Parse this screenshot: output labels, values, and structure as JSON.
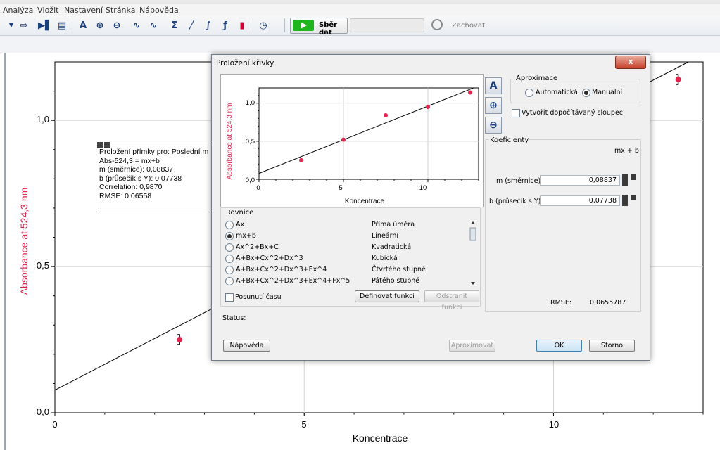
{
  "menu": [
    "Analýza",
    "Vložit",
    "Nastavení",
    "Stránka",
    "Nápověda"
  ],
  "toolbar": {
    "collect_label": "Sběr dat",
    "keep_label": "Zachovat"
  },
  "graph": {
    "y_axis_title": "Absorbance at 524,3 nm",
    "x_axis_title": "Koncentrace",
    "y_ticks": [
      "0,0",
      "0,5",
      "1,0"
    ],
    "x_ticks": [
      "0",
      "5",
      "10"
    ],
    "accent_color": "#e0254f"
  },
  "fit_box": {
    "line1": "Proložení přímky pro: Poslední m",
    "line2": "Abs-524,3 = mx+b",
    "line3": "m (směrnice): 0,08837",
    "line4": "b (průsečík s Y): 0,07738",
    "line5": "Correlation: 0,9870",
    "line6": "RMSE: 0,06558"
  },
  "dialog": {
    "title": "Proložení křivky",
    "close": "x",
    "plot": {
      "ylabel": "Absorbance at 524,3 nm",
      "xlabel": "Koncentrace",
      "y_ticks": [
        "0,0",
        "0,5",
        "1,0"
      ],
      "x_ticks": [
        "0",
        "5",
        "10"
      ]
    },
    "approx": {
      "title": "Aproximace",
      "auto": "Automatická",
      "manual": "Manuální",
      "selected": "Manuální"
    },
    "computed_column_label": "Vytvořit dopočítávaný sloupec",
    "coefficients": {
      "title": "Koeficienty",
      "formula": "mx + b",
      "m_label": "m (směrnice)",
      "m_value": "0,08837",
      "b_label": "b (průsečík s Y)",
      "b_value": "0,07738",
      "rmse_label": "RMSE:",
      "rmse_value": "0,0655787"
    },
    "equations": {
      "title": "Rovnice",
      "selected": "mx+b",
      "rows": [
        {
          "formula": "Ax",
          "name": "Přímá úměra"
        },
        {
          "formula": "mx+b",
          "name": "Lineární"
        },
        {
          "formula": "Ax^2+Bx+C",
          "name": "Kvadratická"
        },
        {
          "formula": "A+Bx+Cx^2+Dx^3",
          "name": "Kubická"
        },
        {
          "formula": "A+Bx+Cx^2+Dx^3+Ex^4",
          "name": "Čtvrtého stupně"
        },
        {
          "formula": "A+Bx+Cx^2+Dx^3+Ex^4+Fx^5",
          "name": "Pátého stupně"
        }
      ]
    },
    "time_shift_label": "Posunutí času",
    "define_function": "Definovat funkci",
    "remove_function": "Odstranit funkci",
    "status_label": "Status:",
    "help": "Nápověda",
    "approximate": "Aproximovat",
    "ok": "OK",
    "cancel": "Storno"
  },
  "chart_data": [
    {
      "type": "scatter",
      "xlabel": "Koncentrace",
      "ylabel": "Absorbance at 524,3 nm",
      "xlim": [
        0,
        13
      ],
      "ylim": [
        0,
        1.2
      ],
      "x_ticks": [
        0,
        5,
        10
      ],
      "y_ticks": [
        0,
        0.5,
        1
      ],
      "points": [
        {
          "x": 2.5,
          "y": 0.25
        },
        {
          "x": 5,
          "y": 0.52
        },
        {
          "x": 7.5,
          "y": 0.84
        },
        {
          "x": 10,
          "y": 0.95
        },
        {
          "x": 12.5,
          "y": 1.14
        }
      ],
      "fit": {
        "m": 0.08837,
        "b": 0.07738
      }
    }
  ]
}
